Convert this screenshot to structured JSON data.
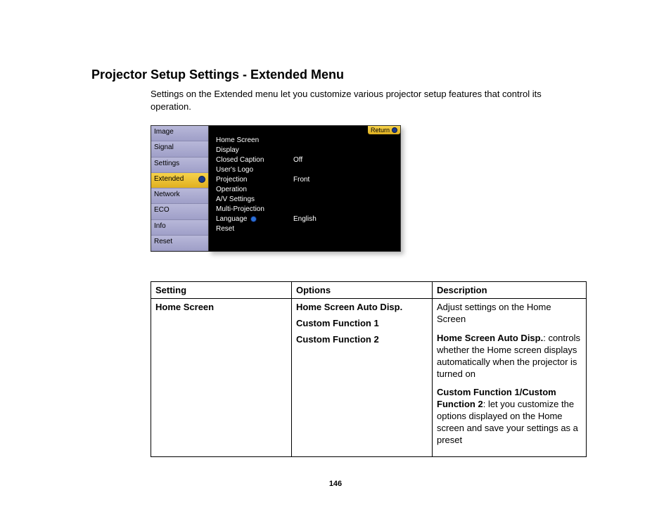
{
  "heading": "Projector Setup Settings - Extended Menu",
  "intro": "Settings on the Extended menu let you customize various projector setup features that control its operation.",
  "osd": {
    "return_label": "Return",
    "sidebar": [
      {
        "label": "Image",
        "active": false
      },
      {
        "label": "Signal",
        "active": false
      },
      {
        "label": "Settings",
        "active": false
      },
      {
        "label": "Extended",
        "active": true
      },
      {
        "label": "Network",
        "active": false
      },
      {
        "label": "ECO",
        "active": false
      },
      {
        "label": "Info",
        "active": false
      },
      {
        "label": "Reset",
        "active": false
      }
    ],
    "rows": [
      {
        "label": "Home Screen",
        "value": ""
      },
      {
        "label": "Display",
        "value": ""
      },
      {
        "label": "Closed Caption",
        "value": "Off"
      },
      {
        "label": "User's Logo",
        "value": ""
      },
      {
        "label": "Projection",
        "value": "Front"
      },
      {
        "label": "Operation",
        "value": ""
      },
      {
        "label": "A/V Settings",
        "value": ""
      },
      {
        "label": "Multi-Projection",
        "value": ""
      },
      {
        "label": "Language",
        "value": "English",
        "icon": true
      },
      {
        "label": "Reset",
        "value": ""
      }
    ]
  },
  "table": {
    "headers": {
      "setting": "Setting",
      "options": "Options",
      "description": "Description"
    },
    "row": {
      "setting": "Home Screen",
      "options": [
        "Home Screen Auto Disp.",
        "Custom Function 1",
        "Custom Function 2"
      ],
      "desc": {
        "p1": "Adjust settings on the Home Screen",
        "p2_b": "Home Screen Auto Disp.",
        "p2": ": controls whether the Home screen displays automatically when the projector is turned on",
        "p3_b": "Custom Function 1/Custom Function 2",
        "p3": ": let you customize the options displayed on the Home screen and save your settings as a preset"
      }
    }
  },
  "page_number": "146"
}
